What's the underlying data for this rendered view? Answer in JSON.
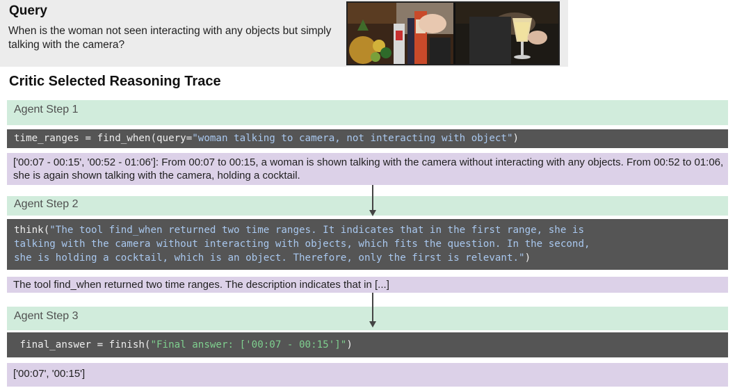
{
  "query": {
    "title": "Query",
    "text": "When is the woman not seen interacting with any objects but simply talking with the camera?"
  },
  "trace": {
    "title": "Critic Selected Reasoning Trace",
    "steps": [
      {
        "label": "Agent Step 1",
        "code_prefix": "time_ranges = find_when(query=",
        "code_string": "\"woman talking to camera, not interacting with object\"",
        "code_suffix": ")",
        "output": "['00:07 - 00:15', '00:52 - 01:06']: From 00:07 to 00:15, a woman is shown talking with the camera without interacting with any objects. From 00:52 to 01:06, she is again shown talking with the camera, holding a cocktail."
      },
      {
        "label": "Agent Step 2",
        "code_prefix": "think(",
        "code_string_lines": [
          "\"The tool find_when returned two time ranges. It indicates that in the first range, she is",
          "talking with the camera without interacting with objects, which fits the question. In the second,",
          "she is holding a cocktail, which is an object. Therefore, only the first is relevant.\""
        ],
        "code_suffix": ")",
        "output": "The tool find_when returned two time ranges. The description indicates that in [...]"
      },
      {
        "label": "Agent Step 3",
        "code_prefix": " final_answer = finish(",
        "code_string": "\"Final answer: ['00:07 - 00:15']\"",
        "code_suffix": ")",
        "output": "['00:07', '00:15']"
      }
    ]
  },
  "colors": {
    "step_band": "#d1ecdc",
    "code_band": "#555555",
    "output_band": "#dcd1e8",
    "query_bg": "#ececec"
  }
}
